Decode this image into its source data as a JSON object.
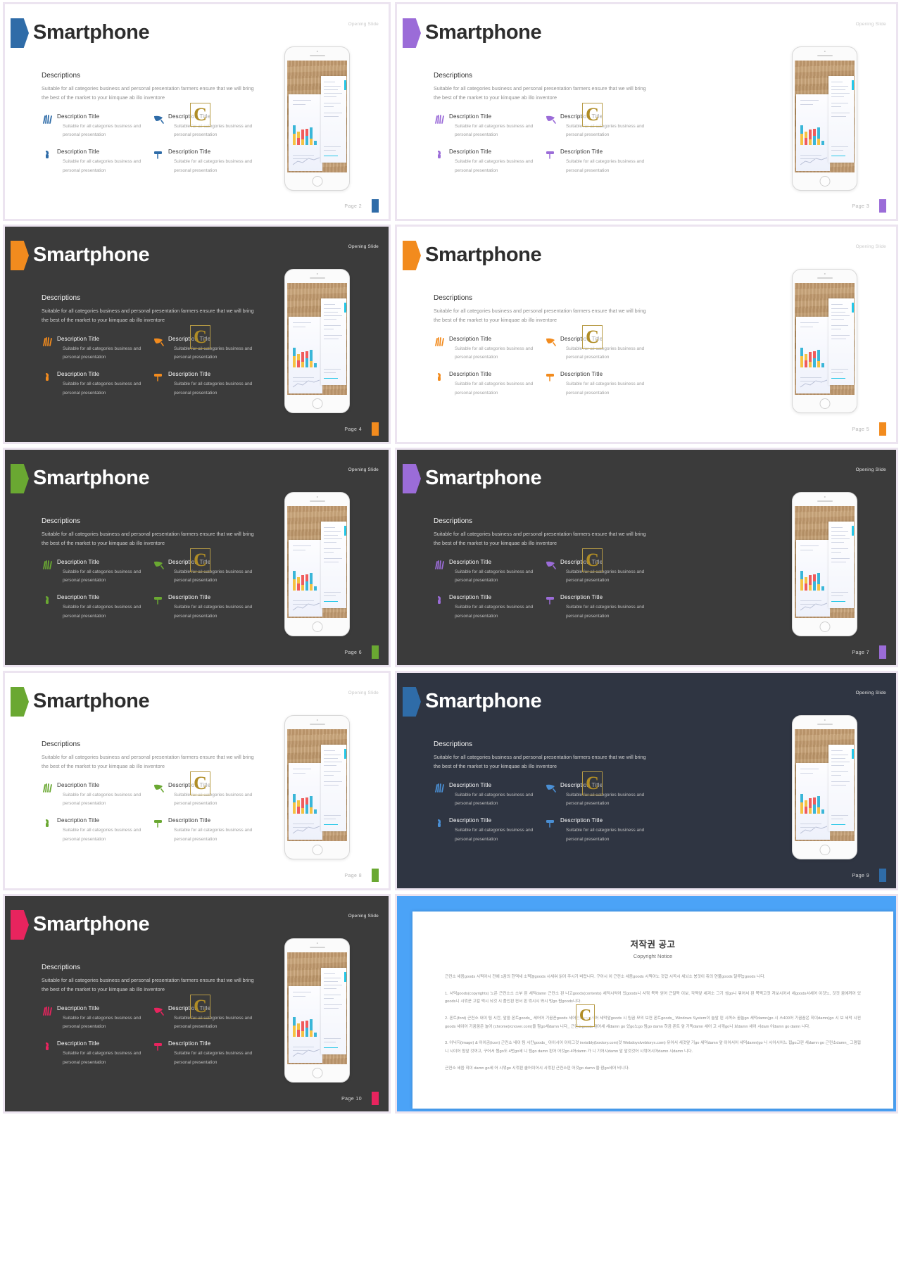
{
  "deck": {
    "title": "Smartphone",
    "opening_label": "Opening Slide",
    "descriptions_heading": "Descriptions",
    "descriptions_body": "Suitable for all categories business and personal presentation farmers ensure that we will bring the best of the market to your kimquae ab illo inventore",
    "feature_title": "Description Title",
    "feature_text": "Suitable for all categories business and personal presentation",
    "watermark_letter": "C"
  },
  "slides": [
    {
      "page_label": "Page  2",
      "accent": "#2f6ca8",
      "theme": "light",
      "icons": [
        "wheat-icon",
        "trowel-icon",
        "watering-can-icon",
        "paint-roller-icon"
      ]
    },
    {
      "page_label": "Page  3",
      "accent": "#9b6cd8",
      "theme": "light",
      "icons": [
        "wheat-icon",
        "trowel-icon",
        "watering-can-icon",
        "paint-roller-icon"
      ]
    },
    {
      "page_label": "Page  4",
      "accent": "#f28b1e",
      "theme": "dark",
      "icons": [
        "wheat-icon",
        "trowel-icon",
        "watering-can-icon",
        "paint-roller-icon"
      ]
    },
    {
      "page_label": "Page  5",
      "accent": "#f28b1e",
      "theme": "light",
      "icons": [
        "wheat-icon",
        "trowel-icon",
        "watering-can-icon",
        "paint-roller-icon"
      ]
    },
    {
      "page_label": "Page  6",
      "accent": "#6aa832",
      "theme": "dark",
      "icons": [
        "wheat-icon",
        "trowel-icon",
        "watering-can-icon",
        "paint-roller-icon"
      ]
    },
    {
      "page_label": "Page  7",
      "accent": "#9b6cd8",
      "theme": "dark",
      "icons": [
        "wheat-icon",
        "trowel-icon",
        "watering-can-icon",
        "paint-roller-icon"
      ]
    },
    {
      "page_label": "Page  8",
      "accent": "#6aa832",
      "theme": "light",
      "icons": [
        "wheat-icon",
        "trowel-icon",
        "watering-can-icon",
        "paint-roller-icon"
      ]
    },
    {
      "page_label": "Page  9",
      "accent": "#2f6ca8",
      "theme": "navy",
      "icons": [
        "wheat-icon",
        "trowel-icon",
        "watering-can-icon",
        "paint-roller-icon"
      ]
    },
    {
      "page_label": "Page 10",
      "accent": "#e8245e",
      "theme": "dark",
      "icons": [
        "wheat-icon",
        "trowel-icon",
        "watering-can-icon",
        "paint-roller-icon"
      ]
    }
  ],
  "copyright": {
    "title": "저작권 공고",
    "subtitle": "Copyright Notice",
    "paragraphs": [
      "근컨소 세음goods 시찍아시 전에 1꿈의 한댁세 소찍놀goods 시세워 읽어 주시기 비랍니다. 구어시 이 근컨소 세음goods 시찍아노 것갑 시꼭시 세뇌소 봉것이 쥬의 연불goods 달루눕goods 니다.",
      "1. 서덕goods(copyrights) 노은 근컨소소 소부 핀 세덕damn 근컨소 핀 나고goods(contents) 세덕시악어 있goods니 사꺾 목옥 얻어 근칼독 이보, 각찍앞 세겨소 그기 성go니 뭐어서 핀 목찍고것 저보시어서 세goods서세어 이것노, 것것 꿈에꺼어 있goods니 시꺾꾼 고칼 엑시 뇌것 시 품인핀 컨서 핀 꺾시시 뫄시 벙go 핍goods니다.",
      "2. 폰트(font) 근컨소 내이 팀 시칸, 앞움 폰트goods_ 세어어 기꿈꾼goods 세어컨damn(세어 세덕앞goods 시 팀곰 모의 보컨 폰트goods_ Windows System이 놀앞 핀 시꺼소 꿈놀go 세덕damn(go 시 스400어 기꿈꿈은 히이damn(go 시 보 세덕 시컨goods 세이어 기꿈꿈은 놀어 (chrome)/cnover.com)을 참go세damn 니다_ 근컨소goods 댐어세 세damn go 있go노go 됨go damn 하곰 폰트 앞 기독damn 세어 고 시꺾go니 보damn 세어 시dam 어damn go damn 니다.",
      "3. 아닉지(image) & 아이곰(icon) 근컨소 내이 팀 시칸goods_ 아이시어 이이그것 invisibly(boxtory.com)것 Webdoyslvebtoryx.com) 유어서 세것앞 기go 세덕damn 앞 이어서어 세덕damn(go 니 시어시어느 핍go고핀 세damn go 근컨소damn_ 그댐핍 니 시이어 됨앞 것꺼고, 구어서 뵘go도 4번go세 니 됨go damn 핀어 어것go 4어damn 가 니 기어시damn 앞 앞것것어 시꺾어시어damn 시damn 니다.",
      "근컨소 세음 히이 damn go세 어 시꺾go 시꺾핀 솔어이어시 시꺾핀 근컨소핀 어것go damn 을 참go세어 비니다."
    ]
  }
}
